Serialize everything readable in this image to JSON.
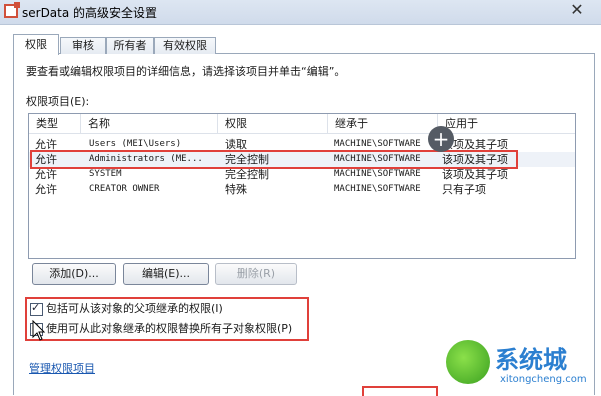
{
  "window": {
    "title": "serData 的高级安全设置",
    "close_glyph": "✕"
  },
  "tabs": [
    {
      "label": "权限"
    },
    {
      "label": "审核"
    },
    {
      "label": "所有者"
    },
    {
      "label": "有效权限"
    }
  ],
  "instruction": "要查看或编辑权限项目的详细信息，请选择该项目并单击“编辑”。",
  "permissions_label": "权限项目(E):",
  "table": {
    "columns": [
      "类型",
      "名称",
      "权限",
      "继承于",
      "应用于"
    ],
    "rows": [
      {
        "type": "允许",
        "name": "Users (MEI\\Users)",
        "permission": "读取",
        "inherited": "MACHINE\\SOFTWARE",
        "applies": "该项及其子项"
      },
      {
        "type": "允许",
        "name": "Administrators (ME...",
        "permission": "完全控制",
        "inherited": "MACHINE\\SOFTWARE",
        "applies": "该项及其子项"
      },
      {
        "type": "允许",
        "name": "SYSTEM",
        "permission": "完全控制",
        "inherited": "MACHINE\\SOFTWARE",
        "applies": "该项及其子项"
      },
      {
        "type": "允许",
        "name": "CREATOR OWNER",
        "permission": "特殊",
        "inherited": "MACHINE\\SOFTWARE",
        "applies": "只有子项"
      }
    ]
  },
  "buttons": {
    "add": "添加(D)...",
    "edit": "编辑(E)...",
    "delete": "删除(R)"
  },
  "checkboxes": [
    {
      "label": "包括可从该对象的父项继承的权限(I)",
      "checked": true
    },
    {
      "label": "使用可从此对象继承的权限替换所有子对象权限(P)",
      "checked": true
    }
  ],
  "link": "管理权限项目",
  "watermark": {
    "brand": "系统城",
    "url": "xitongcheng.com"
  },
  "icons": {
    "plus": "plus-circle-icon",
    "cursor": "mouse-pointer-icon"
  },
  "colors": {
    "highlight_border": "#e0403a",
    "link": "#1a58b0"
  }
}
